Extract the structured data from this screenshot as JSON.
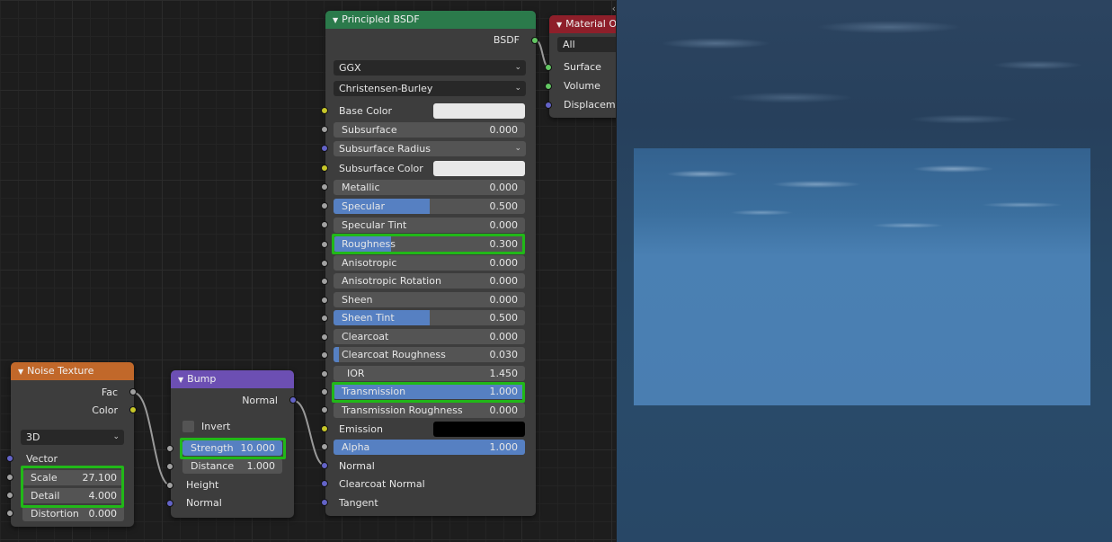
{
  "noise_node": {
    "title": "Noise Texture",
    "outputs": {
      "fac": "Fac",
      "color": "Color"
    },
    "dimensions": "3D",
    "vector": "Vector",
    "scale": {
      "label": "Scale",
      "value": "27.100"
    },
    "detail": {
      "label": "Detail",
      "value": "4.000"
    },
    "distortion": {
      "label": "Distortion",
      "value": "0.000"
    }
  },
  "bump_node": {
    "title": "Bump",
    "output": "Normal",
    "invert": "Invert",
    "strength": {
      "label": "Strength",
      "value": "10.000"
    },
    "distance": {
      "label": "Distance",
      "value": "1.000"
    },
    "height": "Height",
    "normal_in": "Normal"
  },
  "bsdf_node": {
    "title": "Principled BSDF",
    "output": "BSDF",
    "distribution": "GGX",
    "subsurface_method": "Christensen-Burley",
    "inputs": {
      "base_color": "Base Color",
      "subsurface": {
        "label": "Subsurface",
        "value": "0.000"
      },
      "subsurface_radius": "Subsurface Radius",
      "subsurface_color": "Subsurface Color",
      "metallic": {
        "label": "Metallic",
        "value": "0.000"
      },
      "specular": {
        "label": "Specular",
        "value": "0.500"
      },
      "specular_tint": {
        "label": "Specular Tint",
        "value": "0.000"
      },
      "roughness": {
        "label": "Roughness",
        "value": "0.300"
      },
      "anisotropic": {
        "label": "Anisotropic",
        "value": "0.000"
      },
      "anisotropic_rotation": {
        "label": "Anisotropic Rotation",
        "value": "0.000"
      },
      "sheen": {
        "label": "Sheen",
        "value": "0.000"
      },
      "sheen_tint": {
        "label": "Sheen Tint",
        "value": "0.500"
      },
      "clearcoat": {
        "label": "Clearcoat",
        "value": "0.000"
      },
      "clearcoat_roughness": {
        "label": "Clearcoat Roughness",
        "value": "0.030"
      },
      "ior": {
        "label": "IOR",
        "value": "1.450"
      },
      "transmission": {
        "label": "Transmission",
        "value": "1.000"
      },
      "transmission_roughness": {
        "label": "Transmission Roughness",
        "value": "0.000"
      },
      "emission": "Emission",
      "alpha": {
        "label": "Alpha",
        "value": "1.000"
      },
      "normal": "Normal",
      "clearcoat_normal": "Clearcoat Normal",
      "tangent": "Tangent"
    }
  },
  "output_node": {
    "title": "Material O",
    "target": "All",
    "surface": "Surface",
    "volume": "Volume",
    "displacement": "Displaceme"
  },
  "colors": {
    "noise_header": "#c1682a",
    "bump_header": "#6c4fb3",
    "bsdf_header": "#2b7a4b",
    "output_header": "#8e1f2a",
    "slider_fill": "#5680c2",
    "highlight": "#21b818"
  },
  "area_handle": "‹›"
}
